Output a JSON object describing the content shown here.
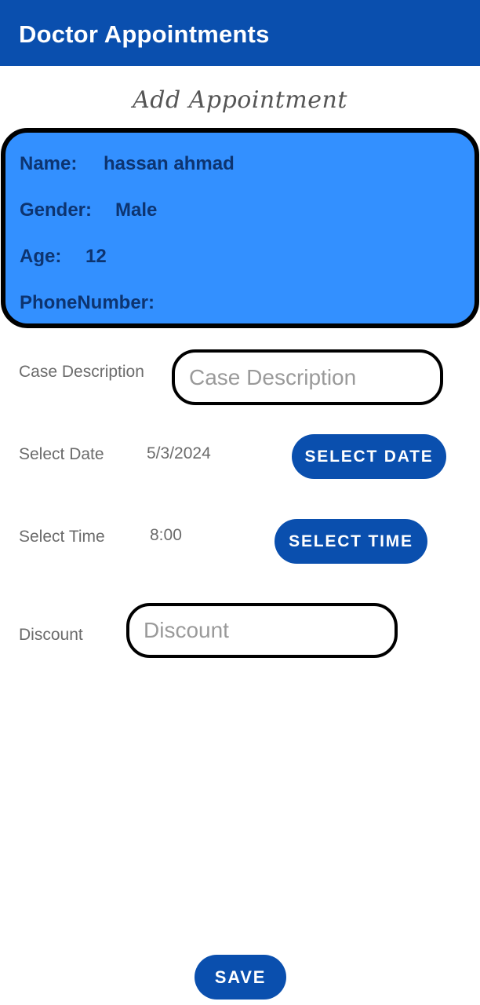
{
  "app_bar": {
    "title": "Doctor Appointments"
  },
  "form": {
    "title": "Add Appointment",
    "patient": {
      "name_label": "Name:",
      "name_value": "hassan ahmad",
      "gender_label": "Gender:",
      "gender_value": "Male",
      "age_label": "Age:",
      "age_value": "12",
      "phone_label": "PhoneNumber:",
      "phone_value": ""
    },
    "case_description": {
      "label": "Case Description",
      "placeholder": "Case Description",
      "value": ""
    },
    "date": {
      "label": "Select Date",
      "value": "5/3/2024",
      "button": "SELECT DATE"
    },
    "time": {
      "label": "Select Time",
      "value": "8:00",
      "button": "SELECT TIME"
    },
    "discount": {
      "label": "Discount",
      "placeholder": "Discount",
      "value": ""
    },
    "save_button": "SAVE"
  },
  "colors": {
    "app_bar": "#0a4fae",
    "card_background": "#3390ff",
    "card_text": "#0d3470",
    "button": "#0a4fae"
  }
}
